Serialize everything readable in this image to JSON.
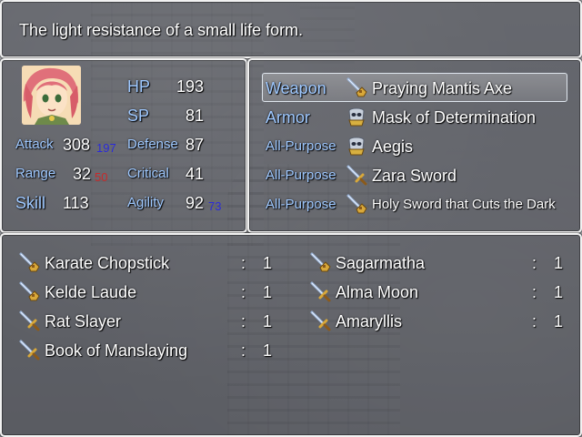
{
  "help_text": "The light resistance of a small life form.",
  "status": {
    "hp_label": "HP",
    "hp": "193",
    "sp_label": "SP",
    "sp": "81",
    "attack_label": "Attack",
    "attack": "308",
    "attack_bonus": "197",
    "range_label": "Range",
    "range": "32",
    "range_bonus": "50",
    "skill_label": "Skill",
    "skill": "113",
    "defense_label": "Defense",
    "defense": "87",
    "critical_label": "Critical",
    "critical": "41",
    "agility_label": "Agility",
    "agility": "92",
    "agility_bonus": "73"
  },
  "equipment": [
    {
      "slot": "Weapon",
      "item": "Praying Mantis Axe",
      "icon": "axe-icon",
      "selected": true
    },
    {
      "slot": "Armor",
      "item": "Mask of Determination",
      "icon": "mask-icon"
    },
    {
      "slot": "All-Purpose",
      "item": "Aegis",
      "icon": "shield-icon"
    },
    {
      "slot": "All-Purpose",
      "item": "Zara Sword",
      "icon": "sword-icon"
    },
    {
      "slot": "All-Purpose",
      "item": "Holy Sword that Cuts the Dark",
      "icon": "axe-icon"
    }
  ],
  "inventory": [
    {
      "name": "Karate Chopstick",
      "sep": ":",
      "count": "1",
      "icon": "axe-icon"
    },
    {
      "name": "Sagarmatha",
      "sep": ":",
      "count": "1",
      "icon": "axe-icon"
    },
    {
      "name": "Kelde Laude",
      "sep": ":",
      "count": "1",
      "icon": "axe-icon"
    },
    {
      "name": "Alma Moon",
      "sep": ":",
      "count": "1",
      "icon": "sword-icon"
    },
    {
      "name": "Rat Slayer",
      "sep": ":",
      "count": "1",
      "icon": "sword-icon"
    },
    {
      "name": "Amaryllis",
      "sep": ":",
      "count": "1",
      "icon": "sword-icon"
    },
    {
      "name": "Book of Manslaying",
      "sep": ":",
      "count": "1",
      "icon": "sword-icon"
    }
  ],
  "colors": {
    "system_text": "#9ec8ff",
    "bonus_blue": "#2b2bd8",
    "bonus_red": "#c82a2a"
  }
}
